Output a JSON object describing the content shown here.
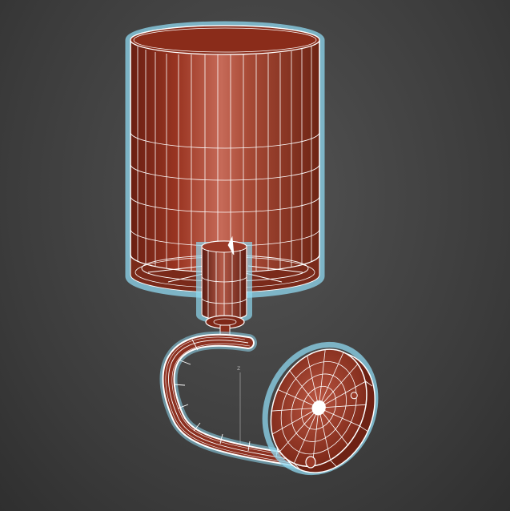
{
  "viewport": {
    "view": "perspective",
    "shading": "edged-faces",
    "background": "#3b3b3b",
    "axis_label": "z"
  },
  "object": {
    "name": "wall-sconce",
    "selected": true,
    "surface_color": "#a43a24",
    "wire_color": "#ffffff",
    "selection_glow": "#8fd8f0",
    "parts": [
      {
        "name": "lamp-shade"
      },
      {
        "name": "lamp-socket"
      },
      {
        "name": "curved-arm"
      },
      {
        "name": "wall-plate"
      }
    ]
  }
}
